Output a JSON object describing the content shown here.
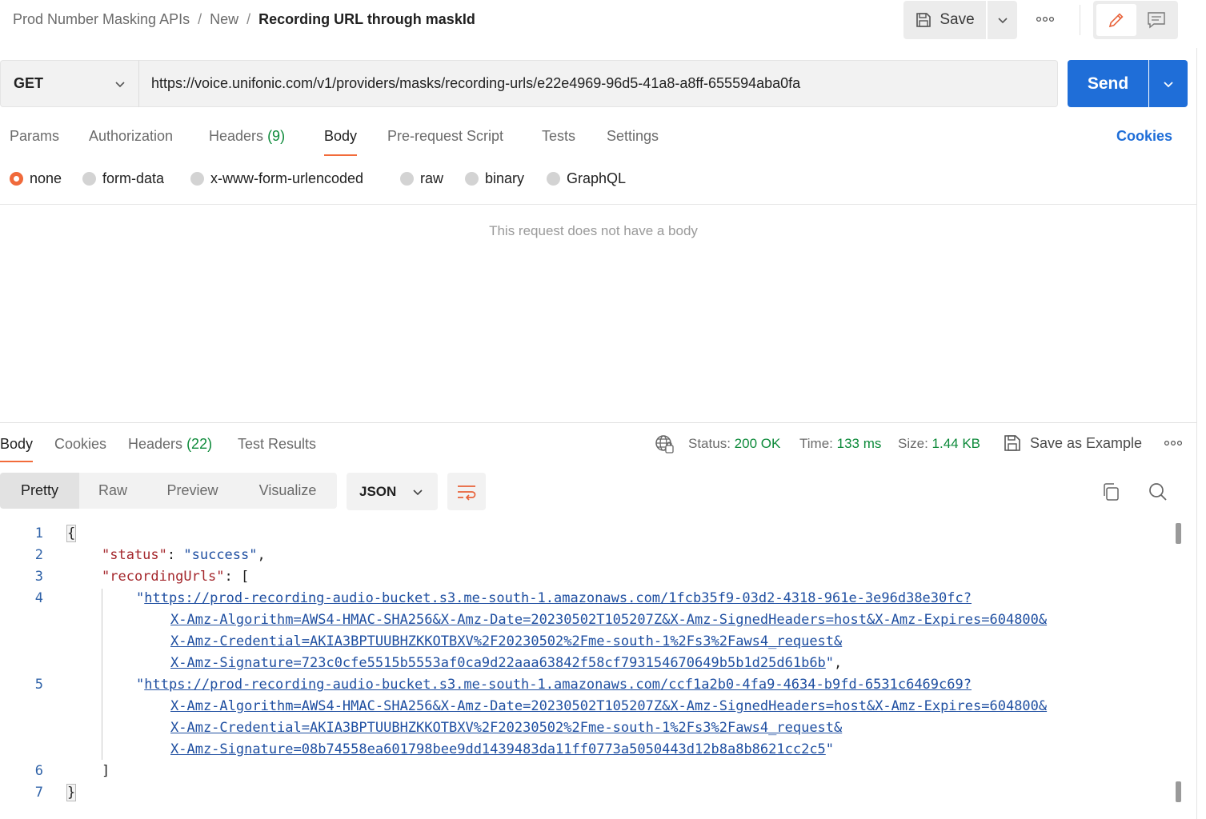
{
  "breadcrumb": {
    "collection": "Prod Number Masking APIs",
    "folder": "New",
    "current": "Recording URL through maskId",
    "separator": "/"
  },
  "toolbar": {
    "save_label": "Save",
    "icons": [
      "save-icon",
      "chevron-down-icon",
      "more-dots-icon",
      "pencil-icon",
      "comment-icon"
    ]
  },
  "request": {
    "method": "GET",
    "url": "https://voice.unifonic.com/v1/providers/masks/recording-urls/e22e4969-96d5-41a8-a8ff-655594aba0fa",
    "send_label": "Send"
  },
  "request_tabs": {
    "params": "Params",
    "authorization": "Authorization",
    "headers": "Headers",
    "headers_count": "(9)",
    "body": "Body",
    "prerequest": "Pre-request Script",
    "tests": "Tests",
    "settings": "Settings",
    "active": "Body",
    "cookies": "Cookies"
  },
  "body_types": {
    "none": "none",
    "form_data": "form-data",
    "urlencoded": "x-www-form-urlencoded",
    "raw": "raw",
    "binary": "binary",
    "graphql": "GraphQL",
    "selected": "none"
  },
  "no_body_message": "This request does not have a body",
  "response_tabs": {
    "body": "Body",
    "cookies": "Cookies",
    "headers": "Headers",
    "headers_count": "(22)",
    "test_results": "Test Results",
    "active": "Body"
  },
  "response_meta": {
    "status_label": "Status:",
    "status_value": "200 OK",
    "time_label": "Time:",
    "time_value": "133 ms",
    "size_label": "Size:",
    "size_value": "1.44 KB",
    "save_example": "Save as Example"
  },
  "response_views": {
    "pretty": "Pretty",
    "raw": "Raw",
    "preview": "Preview",
    "visualize": "Visualize",
    "active": "Pretty",
    "format": "JSON"
  },
  "colors": {
    "accent": "#f26b3a",
    "primary": "#1f6ed8",
    "success": "#0d8a3a",
    "json_key": "#a4272c",
    "json_string": "#1f4fa1"
  },
  "code": {
    "line_numbers": [
      "1",
      "2",
      "3",
      "4",
      "5",
      "6",
      "7"
    ],
    "open_brace": "{",
    "close_brace": "}",
    "status_key": "\"status\"",
    "status_value": "\"success\"",
    "recording_key": "\"recordingUrls\"",
    "open_bracket": "[",
    "close_bracket": "]",
    "url1": [
      "https://prod-recording-audio-bucket.s3.me-south-1.amazonaws.com/1fcb35f9-03d2-4318-961e-3e96d38e30fc?",
      "X-Amz-Algorithm=AWS4-HMAC-SHA256&X-Amz-Date=20230502T105207Z&X-Amz-SignedHeaders=host&X-Amz-Expires=604800&",
      "X-Amz-Credential=AKIA3BPTUUBHZKKOTBXV%2F20230502%2Fme-south-1%2Fs3%2Faws4_request&",
      "X-Amz-Signature=723c0cfe5515b5553af0ca9d22aaa63842f58cf793154670649b5b1d25d61b6b"
    ],
    "url2": [
      "https://prod-recording-audio-bucket.s3.me-south-1.amazonaws.com/ccf1a2b0-4fa9-4634-b9fd-6531c6469c69?",
      "X-Amz-Algorithm=AWS4-HMAC-SHA256&X-Amz-Date=20230502T105207Z&X-Amz-SignedHeaders=host&X-Amz-Expires=604800&",
      "X-Amz-Credential=AKIA3BPTUUBHZKKOTBXV%2F20230502%2Fme-south-1%2Fs3%2Faws4_request&",
      "X-Amz-Signature=08b74558ea601798bee9dd1439483da11ff0773a5050443d12b8a8b8621cc2c5"
    ]
  }
}
